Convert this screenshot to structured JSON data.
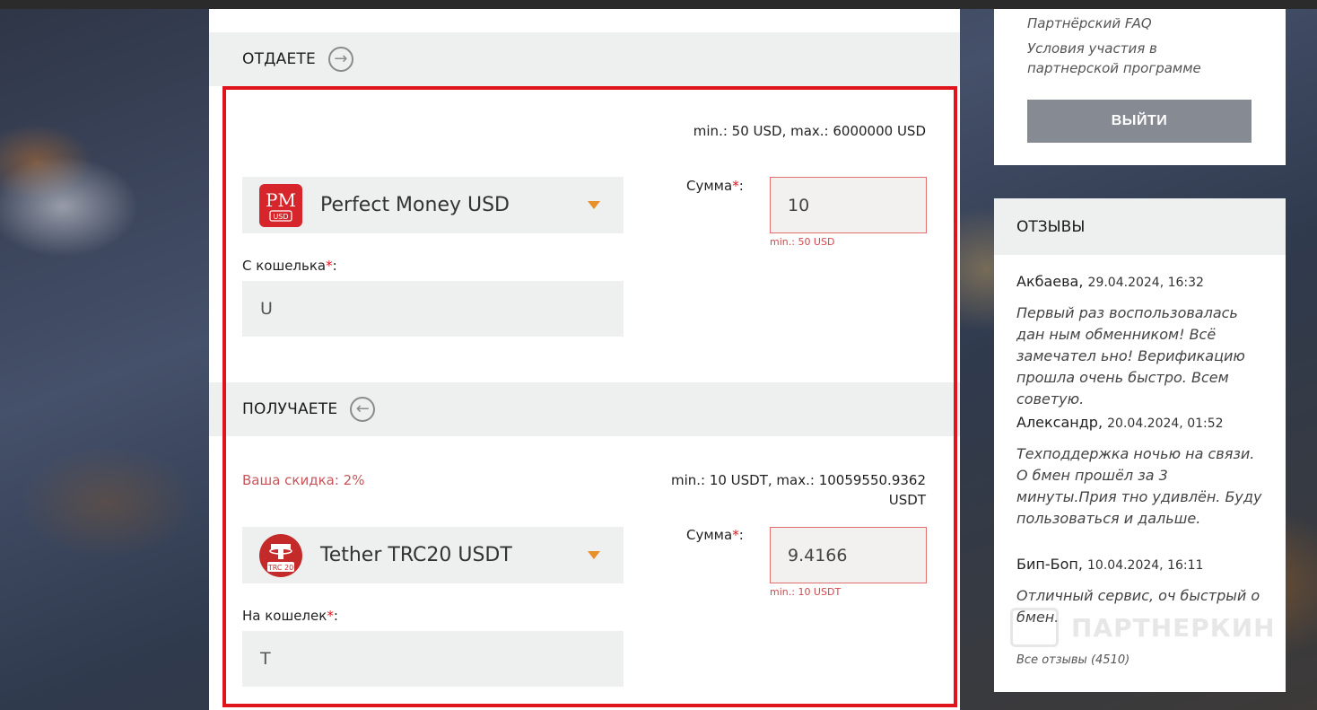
{
  "give": {
    "title": "ОТДАЕТЕ",
    "limits": "min.: 50 USD, max.: 6000000 USD",
    "currency": "Perfect Money USD",
    "sum_label": "Сумма",
    "sum_value": "10",
    "sum_hint": "min.: 50 USD",
    "wallet_label": "С кошелька",
    "wallet_value": "U",
    "logo_top": "PM",
    "logo_bottom": "USD"
  },
  "receive": {
    "title": "ПОЛУЧАЕТЕ",
    "discount": "Ваша скидка: 2%",
    "limits_line1": "min.: 10 USDT, max.: 10059550.9362",
    "limits_line2": "USDT",
    "currency": "Tether TRC20 USDT",
    "sum_label": "Сумма",
    "sum_value": "9.4166",
    "sum_hint": "min.: 10 USDT",
    "wallet_label": "На кошелек",
    "wallet_value": "T",
    "logo_badge": "TRC 20"
  },
  "required_mark": "*",
  "sidebar": {
    "links": [
      "Партнёрский FAQ",
      "Условия участия в",
      "партнерской программе"
    ],
    "logout_label": "ВЫЙТИ",
    "reviews_title": "ОТЗЫВЫ",
    "reviews": [
      {
        "author": "Акбаева,",
        "date": "29.04.2024, 16:32",
        "text": "Первый раз воспользовалась дан ным обменником! Всё замечател ьно! Верификацию прошла очень быстро. Всем советую."
      },
      {
        "author": "Александр,",
        "date": "20.04.2024, 01:52",
        "text": "Техподдержка ночью на связи. О бмен прошёл за 3 минуты.Прия тно удивлён. Буду пользоваться и дальше."
      },
      {
        "author": "Бип-Боп,",
        "date": "10.04.2024, 16:11",
        "text": "Отличный сервис, оч быстрый о бмен."
      }
    ],
    "all_reviews": "Все отзывы (4510)"
  },
  "watermark": "ПАРТНЕРКИН",
  "colors": {
    "accent_red": "#e0141c",
    "caret_orange": "#e8912a",
    "discount": "#c9545a",
    "button_gray": "#858a93"
  }
}
